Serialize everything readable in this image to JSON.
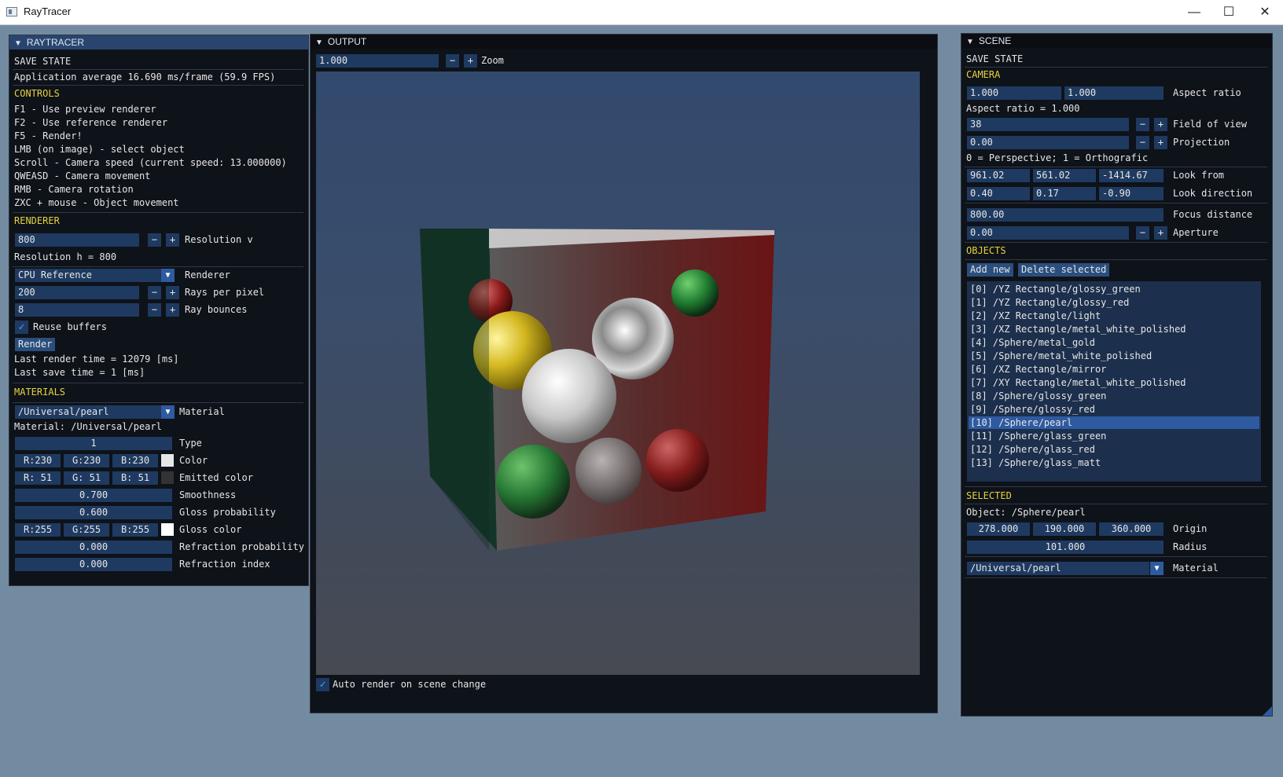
{
  "window": {
    "title": "RayTracer",
    "min": "—",
    "max": "☐",
    "close": "✕"
  },
  "raytracer": {
    "header": "RAYTRACER",
    "save_state": "SAVE STATE",
    "fps": "Application average 16.690 ms/frame (59.9 FPS)",
    "controls_title": "CONTROLS",
    "controls": [
      "F1 - Use preview renderer",
      "F2 - Use reference renderer",
      "F5 - Render!",
      "LMB (on image) - select object",
      "Scroll - Camera speed (current speed: 13.000000)",
      "QWEASD - Camera movement",
      "RMB - Camera rotation",
      "ZXC + mouse - Object movement"
    ],
    "renderer_title": "RENDERER",
    "resolution_v_value": "800",
    "resolution_v_label": "Resolution v",
    "resolution_h": "Resolution h = 800",
    "renderer_value": "CPU Reference",
    "renderer_label": "Renderer",
    "rays_value": "200",
    "rays_label": "Rays per pixel",
    "bounces_value": "8",
    "bounces_label": "Ray bounces",
    "reuse_label": "Reuse buffers",
    "render_button": "Render",
    "last_render": "Last render time = 12079 [ms]",
    "last_save": "Last save time = 1 [ms]",
    "materials_title": "MATERIALS",
    "material_value": "/Universal/pearl",
    "material_label": "Material",
    "material_line": "Material:  /Universal/pearl",
    "type_value": "1",
    "type_label": "Type",
    "color": {
      "r": "R:230",
      "g": "G:230",
      "b": "B:230",
      "label": "Color",
      "swatch": "#e6e6e6"
    },
    "emitted": {
      "r": "R: 51",
      "g": "G: 51",
      "b": "B: 51",
      "label": "Emitted color",
      "swatch": "#333333"
    },
    "smoothness_value": "0.700",
    "smoothness_label": "Smoothness",
    "gloss_prob_value": "0.600",
    "gloss_prob_label": "Gloss probability",
    "gloss": {
      "r": "R:255",
      "g": "G:255",
      "b": "B:255",
      "label": "Gloss color",
      "swatch": "#ffffff"
    },
    "refr_prob_value": "0.000",
    "refr_prob_label": "Refraction probability",
    "refr_index_value": "0.000",
    "refr_index_label": "Refraction index"
  },
  "output": {
    "header": "OUTPUT",
    "zoom_value": "1.000",
    "zoom_label": "Zoom",
    "auto_render_label": "Auto render on scene change"
  },
  "scene": {
    "header": "SCENE",
    "save_state": "SAVE STATE",
    "camera_title": "CAMERA",
    "aspect_a": "1.000",
    "aspect_b": "1.000",
    "aspect_label": "Aspect ratio",
    "aspect_line": "Aspect ratio = 1.000",
    "fov_value": "38",
    "fov_label": "Field of view",
    "proj_value": "0.00",
    "proj_label": "Projection",
    "proj_note": "0 = Perspective; 1 = Orthografic",
    "look_from": [
      "961.02",
      "561.02",
      "-1414.67"
    ],
    "look_from_label": "Look from",
    "look_dir": [
      "0.40",
      "0.17",
      "-0.90"
    ],
    "look_dir_label": "Look direction",
    "focus_value": "800.00",
    "focus_label": "Focus distance",
    "aperture_value": "0.00",
    "aperture_label": "Aperture",
    "objects_title": "OBJECTS",
    "add_new": "Add new",
    "delete_selected": "Delete selected",
    "objects": [
      "[0] /YZ Rectangle/glossy_green",
      "[1] /YZ Rectangle/glossy_red",
      "[2] /XZ Rectangle/light",
      "[3] /XZ Rectangle/metal_white_polished",
      "[4] /Sphere/metal_gold",
      "[5] /Sphere/metal_white_polished",
      "[6] /XZ Rectangle/mirror",
      "[7] /XY Rectangle/metal_white_polished",
      "[8] /Sphere/glossy_green",
      "[9] /Sphere/glossy_red",
      "[10] /Sphere/pearl",
      "[11] /Sphere/glass_green",
      "[12] /Sphere/glass_red",
      "[13] /Sphere/glass_matt"
    ],
    "selected_index": 10,
    "selected_title": "SELECTED",
    "object_line": "Object:  /Sphere/pearl",
    "origin": [
      "278.000",
      "190.000",
      "360.000"
    ],
    "origin_label": "Origin",
    "radius_value": "101.000",
    "radius_label": "Radius",
    "material_value": "/Universal/pearl",
    "material_label": "Material"
  }
}
